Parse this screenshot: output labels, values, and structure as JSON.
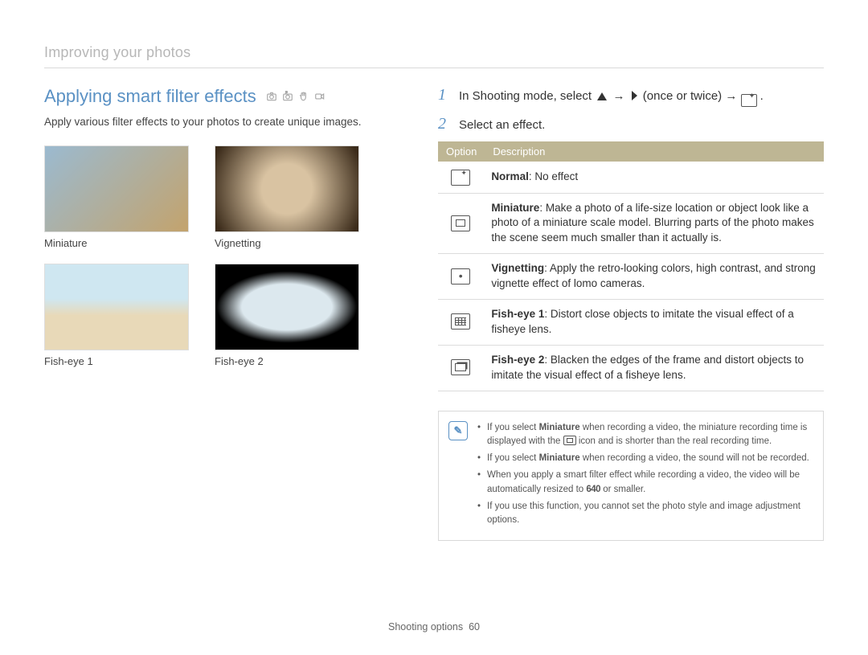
{
  "breadcrumb": "Improving your photos",
  "section_title": "Applying smart filter effects",
  "intro_text": "Apply various filter effects to your photos to create unique images.",
  "samples": [
    {
      "caption": "Miniature"
    },
    {
      "caption": "Vignetting"
    },
    {
      "caption": "Fish-eye 1"
    },
    {
      "caption": "Fish-eye 2"
    }
  ],
  "steps": {
    "s1_prefix": "In Shooting mode, select ",
    "s1_mid": " → ",
    "s1_once": " (once or twice) → ",
    "s1_end": ".",
    "s2": "Select an effect."
  },
  "table": {
    "head_option": "Option",
    "head_desc": "Description",
    "rows": [
      {
        "title": "Normal",
        "desc": ": No effect"
      },
      {
        "title": "Miniature",
        "desc": ": Make a photo of a life-size location or object look like a photo of a miniature scale model. Blurring parts of the photo makes the scene seem much smaller than it actually is."
      },
      {
        "title": "Vignetting",
        "desc": ": Apply the retro-looking colors, high contrast, and strong vignette effect of lomo cameras."
      },
      {
        "title": "Fish-eye 1",
        "desc": ": Distort close objects to imitate the visual effect of a fisheye lens."
      },
      {
        "title": "Fish-eye 2",
        "desc": ": Blacken the edges of the frame and distort objects to imitate the visual effect of a fisheye lens."
      }
    ]
  },
  "notes": {
    "n1a": "If you select ",
    "n1b": "Miniature",
    "n1c": " when recording a video, the miniature recording time is displayed with the ",
    "n1d": " icon and is shorter than the real recording time.",
    "n2a": "If you select ",
    "n2b": "Miniature",
    "n2c": " when recording a video, the sound will not be recorded.",
    "n3a": "When you apply a smart filter effect while recording a video, the video will be automatically resized to ",
    "n3b": "640",
    "n3c": " or smaller.",
    "n4": "If you use this function, you cannot set the photo style and image adjustment options."
  },
  "footer_section": "Shooting options",
  "footer_page": "60"
}
